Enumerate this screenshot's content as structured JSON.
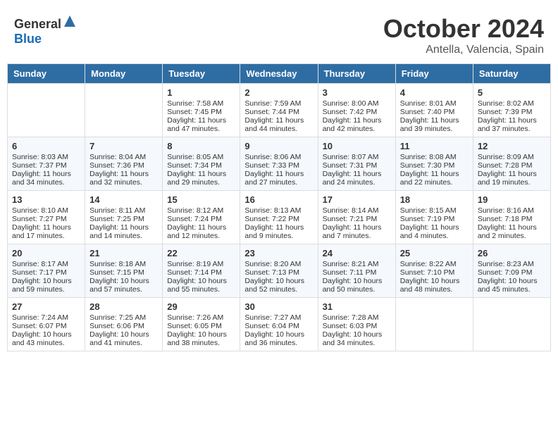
{
  "header": {
    "logo_general": "General",
    "logo_blue": "Blue",
    "month": "October 2024",
    "location": "Antella, Valencia, Spain"
  },
  "days_of_week": [
    "Sunday",
    "Monday",
    "Tuesday",
    "Wednesday",
    "Thursday",
    "Friday",
    "Saturday"
  ],
  "weeks": [
    [
      {
        "day": "",
        "sunrise": "",
        "sunset": "",
        "daylight": ""
      },
      {
        "day": "",
        "sunrise": "",
        "sunset": "",
        "daylight": ""
      },
      {
        "day": "1",
        "sunrise": "Sunrise: 7:58 AM",
        "sunset": "Sunset: 7:45 PM",
        "daylight": "Daylight: 11 hours and 47 minutes."
      },
      {
        "day": "2",
        "sunrise": "Sunrise: 7:59 AM",
        "sunset": "Sunset: 7:44 PM",
        "daylight": "Daylight: 11 hours and 44 minutes."
      },
      {
        "day": "3",
        "sunrise": "Sunrise: 8:00 AM",
        "sunset": "Sunset: 7:42 PM",
        "daylight": "Daylight: 11 hours and 42 minutes."
      },
      {
        "day": "4",
        "sunrise": "Sunrise: 8:01 AM",
        "sunset": "Sunset: 7:40 PM",
        "daylight": "Daylight: 11 hours and 39 minutes."
      },
      {
        "day": "5",
        "sunrise": "Sunrise: 8:02 AM",
        "sunset": "Sunset: 7:39 PM",
        "daylight": "Daylight: 11 hours and 37 minutes."
      }
    ],
    [
      {
        "day": "6",
        "sunrise": "Sunrise: 8:03 AM",
        "sunset": "Sunset: 7:37 PM",
        "daylight": "Daylight: 11 hours and 34 minutes."
      },
      {
        "day": "7",
        "sunrise": "Sunrise: 8:04 AM",
        "sunset": "Sunset: 7:36 PM",
        "daylight": "Daylight: 11 hours and 32 minutes."
      },
      {
        "day": "8",
        "sunrise": "Sunrise: 8:05 AM",
        "sunset": "Sunset: 7:34 PM",
        "daylight": "Daylight: 11 hours and 29 minutes."
      },
      {
        "day": "9",
        "sunrise": "Sunrise: 8:06 AM",
        "sunset": "Sunset: 7:33 PM",
        "daylight": "Daylight: 11 hours and 27 minutes."
      },
      {
        "day": "10",
        "sunrise": "Sunrise: 8:07 AM",
        "sunset": "Sunset: 7:31 PM",
        "daylight": "Daylight: 11 hours and 24 minutes."
      },
      {
        "day": "11",
        "sunrise": "Sunrise: 8:08 AM",
        "sunset": "Sunset: 7:30 PM",
        "daylight": "Daylight: 11 hours and 22 minutes."
      },
      {
        "day": "12",
        "sunrise": "Sunrise: 8:09 AM",
        "sunset": "Sunset: 7:28 PM",
        "daylight": "Daylight: 11 hours and 19 minutes."
      }
    ],
    [
      {
        "day": "13",
        "sunrise": "Sunrise: 8:10 AM",
        "sunset": "Sunset: 7:27 PM",
        "daylight": "Daylight: 11 hours and 17 minutes."
      },
      {
        "day": "14",
        "sunrise": "Sunrise: 8:11 AM",
        "sunset": "Sunset: 7:25 PM",
        "daylight": "Daylight: 11 hours and 14 minutes."
      },
      {
        "day": "15",
        "sunrise": "Sunrise: 8:12 AM",
        "sunset": "Sunset: 7:24 PM",
        "daylight": "Daylight: 11 hours and 12 minutes."
      },
      {
        "day": "16",
        "sunrise": "Sunrise: 8:13 AM",
        "sunset": "Sunset: 7:22 PM",
        "daylight": "Daylight: 11 hours and 9 minutes."
      },
      {
        "day": "17",
        "sunrise": "Sunrise: 8:14 AM",
        "sunset": "Sunset: 7:21 PM",
        "daylight": "Daylight: 11 hours and 7 minutes."
      },
      {
        "day": "18",
        "sunrise": "Sunrise: 8:15 AM",
        "sunset": "Sunset: 7:19 PM",
        "daylight": "Daylight: 11 hours and 4 minutes."
      },
      {
        "day": "19",
        "sunrise": "Sunrise: 8:16 AM",
        "sunset": "Sunset: 7:18 PM",
        "daylight": "Daylight: 11 hours and 2 minutes."
      }
    ],
    [
      {
        "day": "20",
        "sunrise": "Sunrise: 8:17 AM",
        "sunset": "Sunset: 7:17 PM",
        "daylight": "Daylight: 10 hours and 59 minutes."
      },
      {
        "day": "21",
        "sunrise": "Sunrise: 8:18 AM",
        "sunset": "Sunset: 7:15 PM",
        "daylight": "Daylight: 10 hours and 57 minutes."
      },
      {
        "day": "22",
        "sunrise": "Sunrise: 8:19 AM",
        "sunset": "Sunset: 7:14 PM",
        "daylight": "Daylight: 10 hours and 55 minutes."
      },
      {
        "day": "23",
        "sunrise": "Sunrise: 8:20 AM",
        "sunset": "Sunset: 7:13 PM",
        "daylight": "Daylight: 10 hours and 52 minutes."
      },
      {
        "day": "24",
        "sunrise": "Sunrise: 8:21 AM",
        "sunset": "Sunset: 7:11 PM",
        "daylight": "Daylight: 10 hours and 50 minutes."
      },
      {
        "day": "25",
        "sunrise": "Sunrise: 8:22 AM",
        "sunset": "Sunset: 7:10 PM",
        "daylight": "Daylight: 10 hours and 48 minutes."
      },
      {
        "day": "26",
        "sunrise": "Sunrise: 8:23 AM",
        "sunset": "Sunset: 7:09 PM",
        "daylight": "Daylight: 10 hours and 45 minutes."
      }
    ],
    [
      {
        "day": "27",
        "sunrise": "Sunrise: 7:24 AM",
        "sunset": "Sunset: 6:07 PM",
        "daylight": "Daylight: 10 hours and 43 minutes."
      },
      {
        "day": "28",
        "sunrise": "Sunrise: 7:25 AM",
        "sunset": "Sunset: 6:06 PM",
        "daylight": "Daylight: 10 hours and 41 minutes."
      },
      {
        "day": "29",
        "sunrise": "Sunrise: 7:26 AM",
        "sunset": "Sunset: 6:05 PM",
        "daylight": "Daylight: 10 hours and 38 minutes."
      },
      {
        "day": "30",
        "sunrise": "Sunrise: 7:27 AM",
        "sunset": "Sunset: 6:04 PM",
        "daylight": "Daylight: 10 hours and 36 minutes."
      },
      {
        "day": "31",
        "sunrise": "Sunrise: 7:28 AM",
        "sunset": "Sunset: 6:03 PM",
        "daylight": "Daylight: 10 hours and 34 minutes."
      },
      {
        "day": "",
        "sunrise": "",
        "sunset": "",
        "daylight": ""
      },
      {
        "day": "",
        "sunrise": "",
        "sunset": "",
        "daylight": ""
      }
    ]
  ]
}
